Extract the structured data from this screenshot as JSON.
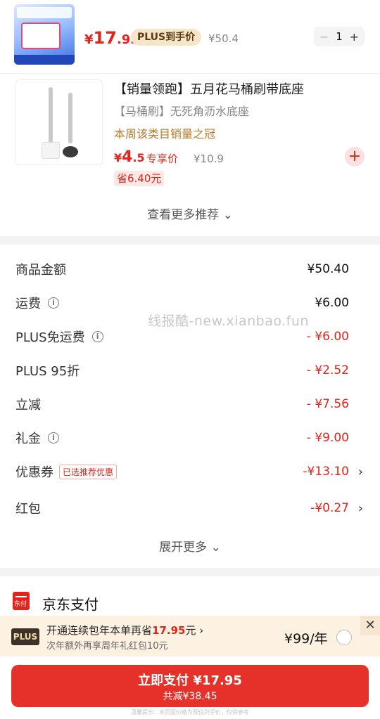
{
  "top_item": {
    "currency": "¥",
    "price_int": "17",
    "price_dec": ".95",
    "plus_label": "PLUS到手价",
    "orig_price": "¥50.4",
    "qty": "1",
    "minus": "−",
    "plus": "+"
  },
  "recommend": {
    "title": "【销量领跑】五月花马桶刷带底座",
    "subtitle": "【马桶刷】无死角沥水底座",
    "rank": "本周该类目销量之冠",
    "currency": "¥",
    "price_int": "4",
    "price_dec": ".5",
    "price_tag": "专享价",
    "orig_price": "¥10.9",
    "save": "省6.40元",
    "add": "+",
    "more": "查看更多推荐 ⌄"
  },
  "summary": {
    "watermark": "线报酷-new.xianbao.fun",
    "rows": [
      {
        "label": "商品金额",
        "value": "¥50.40"
      },
      {
        "label": "运费",
        "value": "¥6.00"
      },
      {
        "label": "PLUS免运费",
        "value": "- ¥6.00"
      },
      {
        "label": "PLUS 95折",
        "value": "- ¥2.52"
      },
      {
        "label": "立减",
        "value": "- ¥7.56"
      },
      {
        "label": "礼金",
        "value": "- ¥9.00"
      },
      {
        "label": "优惠券",
        "badge": "已选推荐优惠",
        "value": "-¥13.10"
      },
      {
        "label": "红包",
        "value": "-¥0.27"
      }
    ],
    "info_glyph": "i",
    "arrow": "›",
    "expand": "展开更多 ⌄"
  },
  "payment": {
    "icon_text": "东付",
    "label": "京东支付"
  },
  "plus_banner": {
    "logo": "PLUS",
    "main_prefix": "开通连续包年本单再省",
    "main_amount": "17.95",
    "main_suffix": "元 ›",
    "sub": "次年额外再享周年礼红包10元",
    "price": "¥99/年",
    "close": "✕"
  },
  "pay_button": {
    "main": "立即支付 ¥17.95",
    "sub": "共减¥38.45"
  },
  "footer_note": "温馨提示：本页面价格为预估到手价，仅供参考"
}
